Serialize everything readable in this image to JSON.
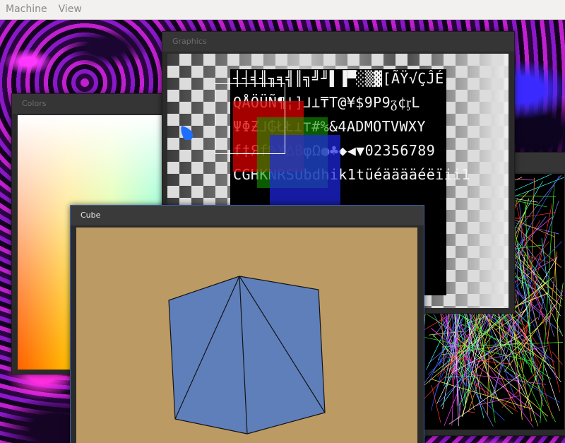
{
  "menubar": {
    "items": [
      {
        "label": "Machine"
      },
      {
        "label": "View"
      }
    ]
  },
  "windows": {
    "graphics": {
      "title": "Graphics"
    },
    "colors": {
      "title": "Colors"
    },
    "cube": {
      "title": "Cube"
    }
  },
  "font_sheet": {
    "rows": [
      "┤┤╡╢╖╕╣║╗╝╜▌▐▀░▒▓[ÃŸ√ÇĴÉ",
      "QÅÖÜÑ¶¦]⅃⊥₸T@¥$9P9ᵹ¢ᶉL",
      "ΨΦƵ⅃₲ŁŁ⊥⊤#%&4ADMOTVWXY",
      "f‡Яf%X∆BφΩ●♣◆◀▼02356789",
      "CGHKNRSUbdhik1tüéääääéëïii1",
      "",
      "",
      "",
      ""
    ]
  },
  "colors": {
    "background": "#5a1a7a",
    "menubar": "#f2f1f0",
    "window": "#2b2b2b",
    "cube_background": "#bc9a63",
    "cube_face": "#5f7fbb",
    "overlay_red": "#dc0000",
    "overlay_green": "#149600",
    "overlay_blue": "#1e28e6",
    "blob": "#1e6fff"
  },
  "icons": {
    "blob": "teardrop-blob"
  }
}
